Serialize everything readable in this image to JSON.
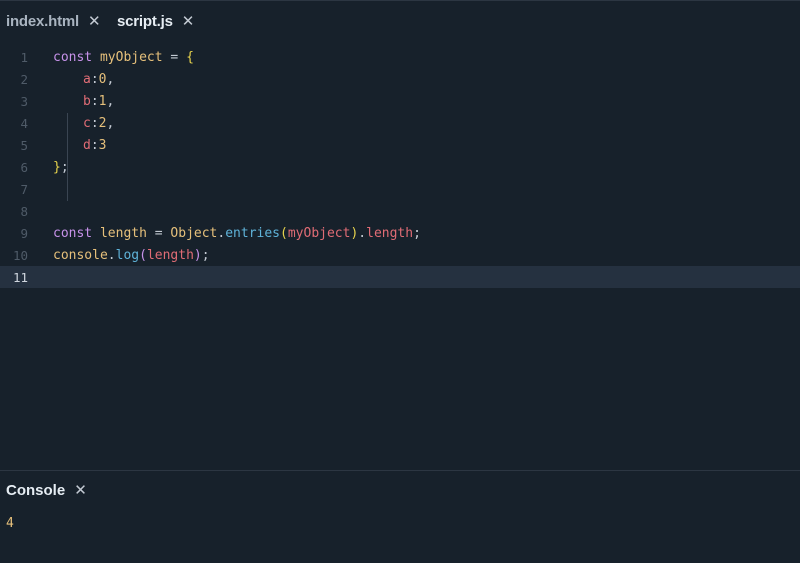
{
  "tabs": [
    {
      "label": "index.html",
      "close": "✕"
    },
    {
      "label": "script.js",
      "close": "✕"
    }
  ],
  "editor": {
    "line_numbers": [
      "1",
      "2",
      "3",
      "4",
      "5",
      "6",
      "7",
      "8",
      "9",
      "10",
      "11"
    ],
    "active_line": "11",
    "code": {
      "l1": {
        "kw": "const",
        "name": "myObject",
        "eq": " = ",
        "brace": "{"
      },
      "l2": {
        "key": "a",
        "colon": ":",
        "val": "0",
        "comma": ","
      },
      "l3": {
        "key": "b",
        "colon": ":",
        "val": "1",
        "comma": ","
      },
      "l4": {
        "key": "c",
        "colon": ":",
        "val": "2",
        "comma": ","
      },
      "l5": {
        "key": "d",
        "colon": ":",
        "val": "3"
      },
      "l6": {
        "brace": "}",
        "semi": ";"
      },
      "l9": {
        "kw": "const",
        "name": "length",
        "eq": " = ",
        "obj": "Object",
        "dot1": ".",
        "fn": "entries",
        "open": "(",
        "arg": "myObject",
        "close": ")",
        "dot2": ".",
        "prop": "length",
        "semi": ";"
      },
      "l10": {
        "obj": "console",
        "dot": ".",
        "fn": "log",
        "open": "(",
        "arg": "length",
        "close": ")",
        "semi": ";"
      }
    }
  },
  "console": {
    "title": "Console",
    "close": "✕",
    "output": "4"
  },
  "colors": {
    "background": "#17212b",
    "keyword": "#c792ea",
    "variable": "#e6c07b",
    "property": "#e06c75",
    "function": "#5fb3d9"
  }
}
